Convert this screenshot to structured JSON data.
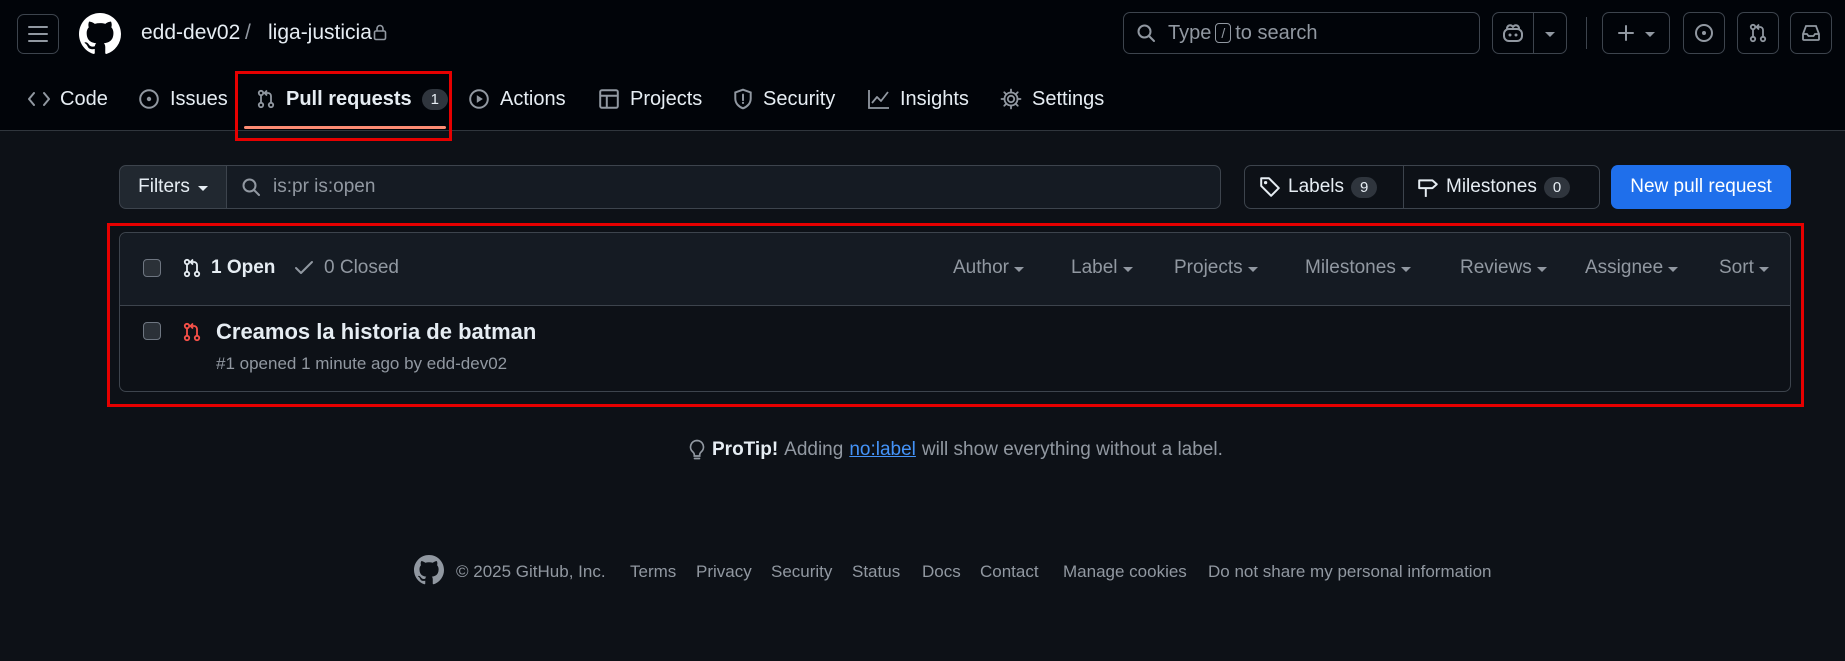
{
  "header": {
    "owner": "edd-dev02",
    "separator": "/",
    "repo": "liga-justicia",
    "search_prefix": "Type",
    "search_key": "/",
    "search_suffix": "to search",
    "plus": "+"
  },
  "tabs": [
    {
      "label": "Code",
      "icon": "code-icon"
    },
    {
      "label": "Issues",
      "icon": "issue-icon"
    },
    {
      "label": "Pull requests",
      "icon": "pull-request-icon",
      "count": "1",
      "selected": true
    },
    {
      "label": "Actions",
      "icon": "play-icon"
    },
    {
      "label": "Projects",
      "icon": "table-icon"
    },
    {
      "label": "Security",
      "icon": "shield-icon"
    },
    {
      "label": "Insights",
      "icon": "graph-icon"
    },
    {
      "label": "Settings",
      "icon": "gear-icon"
    }
  ],
  "filters": {
    "button": "Filters",
    "query": "is:pr is:open",
    "labels": "Labels",
    "labels_count": "9",
    "milestones": "Milestones",
    "milestones_count": "0",
    "new_pr": "New pull request"
  },
  "list": {
    "open": "1 Open",
    "closed": "0 Closed",
    "sort_menus": [
      "Author",
      "Label",
      "Projects",
      "Milestones",
      "Reviews",
      "Assignee",
      "Sort"
    ],
    "items": [
      {
        "title": "Creamos la historia de batman",
        "meta": "#1 opened 1 minute ago by edd-dev02"
      }
    ]
  },
  "protip": {
    "bold": "ProTip!",
    "pre": "Adding",
    "link": "no:label",
    "post": "will show everything without a label."
  },
  "footer": {
    "copyright": "© 2025 GitHub, Inc.",
    "links": [
      "Terms",
      "Privacy",
      "Security",
      "Status",
      "Docs",
      "Contact",
      "Manage cookies",
      "Do not share my personal information"
    ]
  },
  "colors": {
    "accent": "#1f6feb",
    "highlight": "#e60000",
    "pr_closed_icon": "#f85149",
    "link": "#4493f8"
  }
}
